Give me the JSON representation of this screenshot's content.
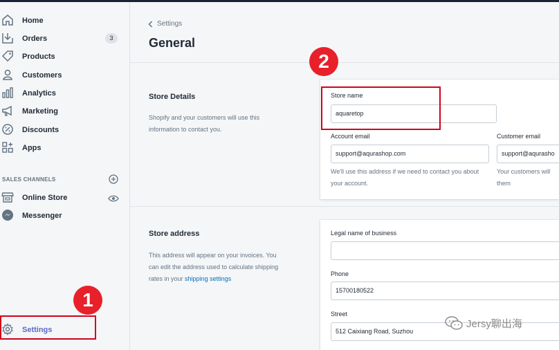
{
  "sidebar": {
    "items": [
      {
        "label": "Home",
        "icon": "home-icon"
      },
      {
        "label": "Orders",
        "icon": "orders-icon",
        "badge": "3"
      },
      {
        "label": "Products",
        "icon": "tag-icon"
      },
      {
        "label": "Customers",
        "icon": "person-icon"
      },
      {
        "label": "Analytics",
        "icon": "bar-chart-icon"
      },
      {
        "label": "Marketing",
        "icon": "megaphone-icon"
      },
      {
        "label": "Discounts",
        "icon": "discount-icon"
      },
      {
        "label": "Apps",
        "icon": "apps-icon"
      }
    ],
    "sales_channels_title": "SALES CHANNELS",
    "channels": [
      {
        "label": "Online Store",
        "icon": "store-icon"
      },
      {
        "label": "Messenger",
        "icon": "messenger-icon"
      }
    ],
    "settings_label": "Settings"
  },
  "annotations": {
    "marker1": "1",
    "marker2": "2",
    "color": "#e8202a"
  },
  "header": {
    "breadcrumb": "Settings",
    "title": "General"
  },
  "store_details": {
    "title": "Store Details",
    "description": "Shopify and your customers will use this information to contact you.",
    "store_name_label": "Store name",
    "store_name_value": "aquaretop",
    "account_email_label": "Account email",
    "account_email_value": "support@aqurashop.com",
    "account_email_help": "We'll use this address if we need to contact you about your account.",
    "customer_email_label": "Customer email",
    "customer_email_value": "support@aqurasho",
    "customer_email_help": "Your customers will them"
  },
  "store_address": {
    "title": "Store address",
    "description_text": "This address will appear on your invoices. You can edit the address used to calculate shipping rates in your",
    "description_link": "shipping settings",
    "legal_name_label": "Legal name of business",
    "legal_name_value": "",
    "phone_label": "Phone",
    "phone_value": "15700180522",
    "street_label": "Street",
    "street_value": "512 Caixiang Road, Suzhou"
  },
  "watermark": {
    "text": "Jersy聊出海"
  }
}
